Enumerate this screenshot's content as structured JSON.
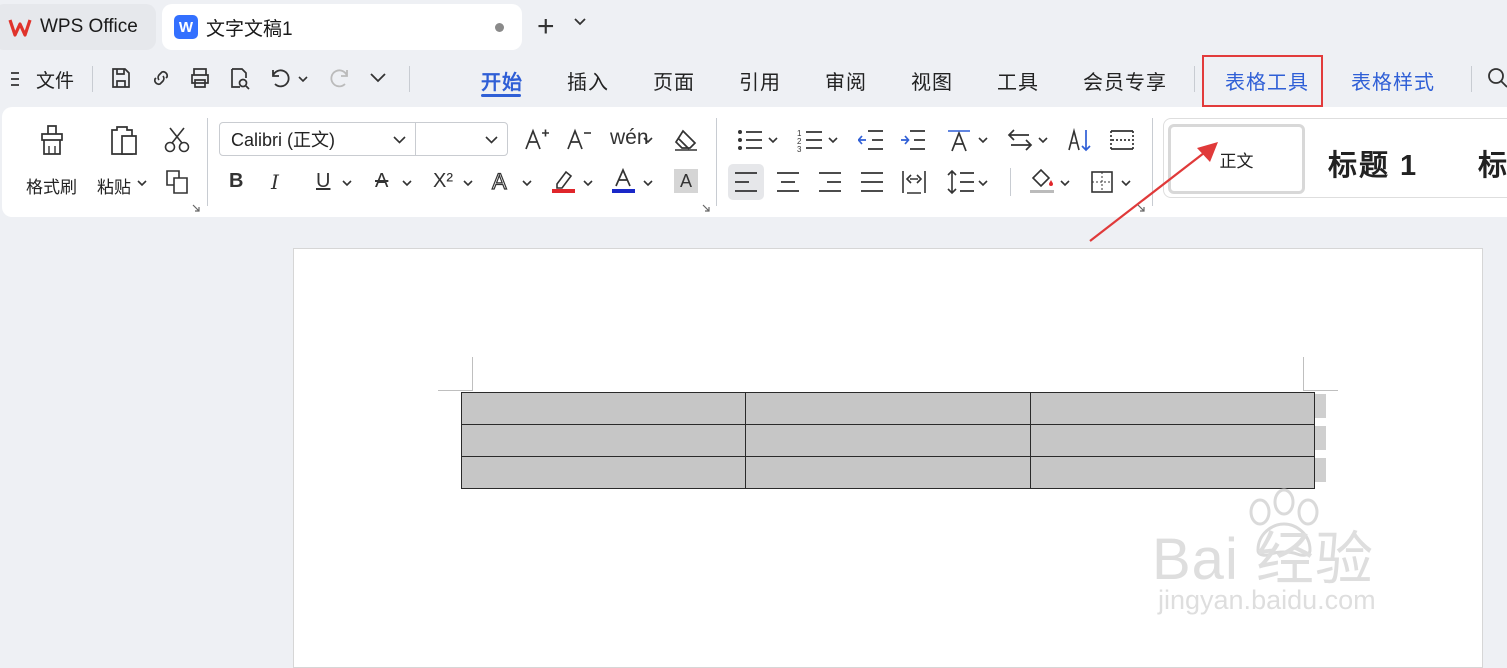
{
  "tabs": {
    "home_label": "WPS Office",
    "doc_label": "文字文稿1"
  },
  "menu": {
    "file_label": "文件",
    "ribbon_tabs": [
      "开始",
      "插入",
      "页面",
      "引用",
      "审阅",
      "视图",
      "工具",
      "会员专享"
    ],
    "context_tabs": [
      "表格工具",
      "表格样式"
    ]
  },
  "ribbon": {
    "format_painter": "格式刷",
    "paste": "粘贴",
    "font_name": "Calibri (正文)",
    "font_size": "",
    "styles": {
      "normal": "正文",
      "heading1": "标题  1",
      "heading2_partial": "标"
    }
  },
  "document": {
    "table": {
      "rows": 3,
      "cols": 3,
      "cells": [
        [
          "",
          "",
          ""
        ],
        [
          "",
          "",
          ""
        ],
        [
          "",
          "",
          ""
        ]
      ]
    }
  },
  "watermark": {
    "main": "Bai 经验",
    "sub": "jingyan.baidu.com"
  },
  "colors": {
    "accent": "#2f5fd6",
    "highlight": "#e23b3b",
    "font_color_bar": "#1a28c8",
    "highlight_color_bar": "#e0262b",
    "table_fill": "#c6c6c6"
  },
  "icons": [
    "wps-logo-icon",
    "word-doc-icon",
    "plus-icon",
    "chevron-down-icon",
    "menu-icon",
    "save-icon",
    "link-icon",
    "print-icon",
    "print-preview-icon",
    "undo-icon",
    "redo-icon",
    "search-icon",
    "format-painter-icon",
    "paste-icon",
    "cut-icon",
    "copy-icon",
    "grow-font-icon",
    "shrink-font-icon",
    "phonetic-icon",
    "clear-format-icon",
    "bold-icon",
    "italic-icon",
    "underline-icon",
    "strikethrough-icon",
    "superscript-icon",
    "text-effect-icon",
    "highlight-icon",
    "font-color-icon",
    "char-shading-icon",
    "bullet-list-icon",
    "numbered-list-icon",
    "decrease-indent-icon",
    "increase-indent-icon",
    "text-direction-icon",
    "swap-icon",
    "sort-icon",
    "show-marks-icon",
    "align-left-icon",
    "align-center-icon",
    "align-right-icon",
    "justify-icon",
    "distribute-icon",
    "line-spacing-icon",
    "shading-icon",
    "borders-icon",
    "dialog-launcher-icon",
    "arrow-annotation-icon"
  ]
}
